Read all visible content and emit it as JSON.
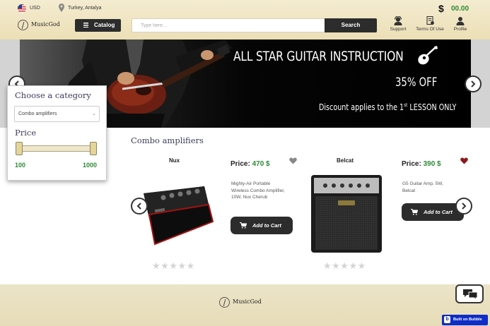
{
  "header": {
    "currency": "USD",
    "location": "Turkey, Antalya",
    "balance_symbol": "$",
    "balance": "00.00",
    "logo_text": "MusicGod",
    "catalog_label": "Catalog",
    "search_placeholder": "Type here...",
    "search_label": "Search",
    "links": [
      {
        "label": "Support",
        "icon": "support-agent-icon"
      },
      {
        "label": "Terms Of Use",
        "icon": "document-icon"
      },
      {
        "label": "Profile",
        "icon": "user-icon"
      }
    ]
  },
  "banner": {
    "title": "ALL STAR GUITAR INSTRUCTION",
    "discount": "35% OFF",
    "note_prefix": "Discount applies to the 1",
    "note_sup": "st",
    "note_suffix": " LESSON ONLY"
  },
  "filter": {
    "category_heading": "Choose a category",
    "selected_category": "Combo amplifiers",
    "price_heading": "Price",
    "price_min": "100",
    "price_max": "1000"
  },
  "products_section": {
    "title": "Combo amplifiers",
    "items": [
      {
        "name": "Nux",
        "price_label": "Price:",
        "price": "470 $",
        "description": "Mighty-Air Portable Wireless Combo Amplifier, 10W, Nux Cherub",
        "favorited": false,
        "add_to_cart": "Add to Cart",
        "rating": 0
      },
      {
        "name": "Belcat",
        "price_label": "Price:",
        "price": "390 $",
        "description": "G5 Guitar Amp, 5W, Belcat",
        "favorited": true,
        "add_to_cart": "Add to Cart",
        "rating": 0
      }
    ]
  },
  "footer": {
    "logo_text": "MusicGod",
    "bubble_badge": "Built on Bubble"
  },
  "colors": {
    "header_bg": "#ecdfb6",
    "accent_dark": "#2c2c2c",
    "price_green": "#2d8a34",
    "heart_active": "#8b1a1a",
    "heart_inactive": "#888888"
  }
}
